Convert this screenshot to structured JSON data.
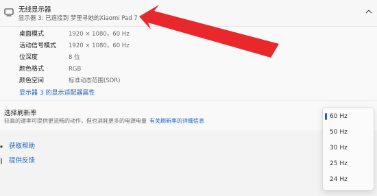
{
  "display": {
    "title": "无线显示器",
    "subtitle": "显示器 3: 已连接到 梦里寻她的Xiaomi Pad 7",
    "icon": "monitor-icon",
    "expanded_icon": "chevron-up-icon"
  },
  "details": {
    "rows": [
      {
        "label": "桌面模式",
        "value": "1920 × 1080，60 Hz"
      },
      {
        "label": "活动信号模式",
        "value": "1920 × 1080，60 Hz"
      },
      {
        "label": "位深度",
        "value": "8 位"
      },
      {
        "label": "颜色格式",
        "value": "RGB"
      },
      {
        "label": "颜色空间",
        "value": "标准动态范围(SDR)"
      }
    ],
    "adapter_link": "显示器 3 的显示适配器属性"
  },
  "refresh": {
    "title": "选择刷新率",
    "description": "较高的速率可提供更流畅的动作，但也消耗更多的电源电量",
    "link": "有关刷新率的详细信息",
    "options": [
      "60 Hz",
      "50 Hz",
      "30 Hz",
      "25 Hz",
      "24 Hz"
    ],
    "selected": "60 Hz"
  },
  "help": {
    "get_help": "获取帮助",
    "feedback": "提供反馈"
  },
  "colors": {
    "accent": "#1f5fb8",
    "annotation_arrow": "#e8282b"
  }
}
